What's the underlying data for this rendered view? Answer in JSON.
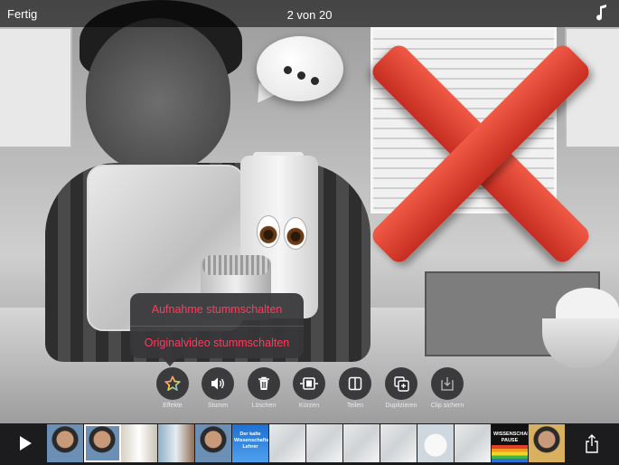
{
  "header": {
    "done_label": "Fertig",
    "title": "2 von 20",
    "music_icon": "music-note-icon"
  },
  "popup_menu": {
    "items": [
      {
        "label": "Aufnahme  stummschalten"
      },
      {
        "label": "Originalvideo stummschalten"
      }
    ]
  },
  "toolbar": {
    "tools": [
      {
        "label": "Effekte",
        "icon": "star-icon"
      },
      {
        "label": "Stumm",
        "icon": "speaker-icon"
      },
      {
        "label": "Löschen",
        "icon": "trash-icon"
      },
      {
        "label": "Kürzen",
        "icon": "trim-icon"
      },
      {
        "label": "Teilen",
        "icon": "split-icon"
      },
      {
        "label": "Duplizieren",
        "icon": "duplicate-icon"
      },
      {
        "label": "Clip sichern",
        "icon": "save-clip-icon"
      }
    ]
  },
  "timeline": {
    "thumbnails": [
      {
        "kind": "boy",
        "text": ""
      },
      {
        "kind": "boy",
        "text": "",
        "selected": true
      },
      {
        "kind": "milk",
        "text": ""
      },
      {
        "kind": "boy-ice",
        "text": ""
      },
      {
        "kind": "boy",
        "text": ""
      },
      {
        "kind": "blue-title",
        "text": "Der kalte Wissenschafts-Lehrer"
      },
      {
        "kind": "kitchen",
        "text": ""
      },
      {
        "kind": "kitchen",
        "text": ""
      },
      {
        "kind": "kitchen",
        "text": ""
      },
      {
        "kind": "kitchen",
        "text": ""
      },
      {
        "kind": "ice",
        "text": ""
      },
      {
        "kind": "kitchen",
        "text": ""
      },
      {
        "kind": "rainbow-title",
        "text": "WISSENSCHAFTS-PAUSE"
      },
      {
        "kind": "boy-color",
        "text": ""
      }
    ]
  },
  "colors": {
    "accent_red": "#ff3b5c",
    "x_red": "#e8473a",
    "toolbar_bg": "#2d2d30"
  }
}
